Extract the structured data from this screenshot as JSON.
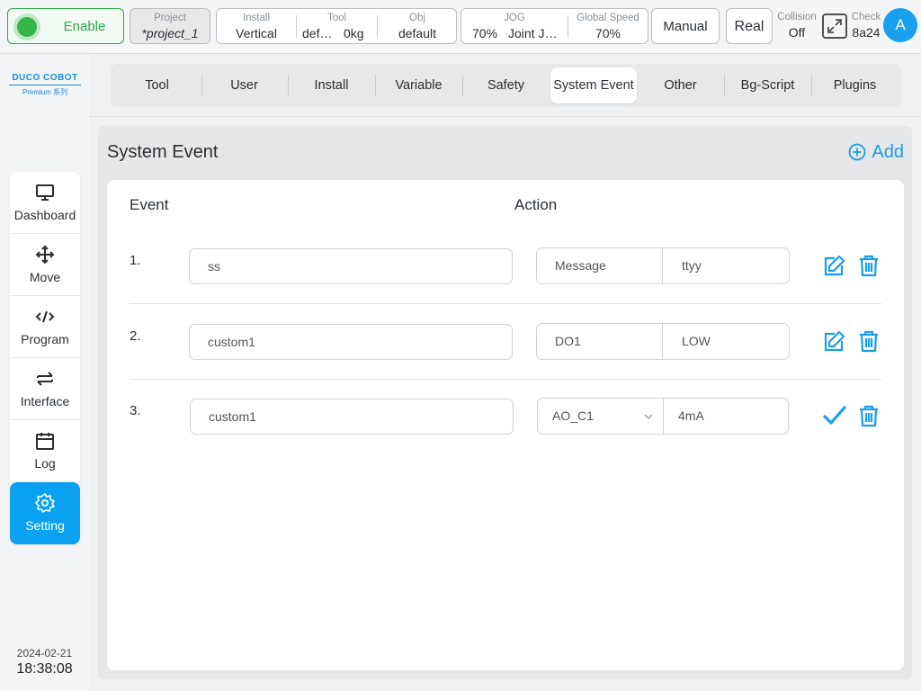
{
  "topbar": {
    "enable_label": "Enable",
    "project": {
      "caption": "Project",
      "value": "*project_1"
    },
    "install": {
      "caption": "Install",
      "value": "Vertical"
    },
    "tool": {
      "caption": "Tool",
      "name": "def…",
      "load": "0kg"
    },
    "obj": {
      "caption": "Obj",
      "value": "default"
    },
    "jog": {
      "caption": "JOG",
      "speed": "70%",
      "mode": "Joint J…"
    },
    "global_speed": {
      "caption": "Global Speed",
      "value": "70%"
    },
    "manual_label": "Manual",
    "real_label": "Real",
    "collision": {
      "caption": "Collision",
      "value": "Off"
    },
    "check": {
      "caption": "Check",
      "value": "8a24"
    },
    "avatar_letter": "A"
  },
  "sidebar": {
    "logo_main": "DUCO COBOT",
    "logo_sub": "Premium 系列",
    "items": [
      {
        "label": "Dashboard",
        "icon": "monitor-icon"
      },
      {
        "label": "Move",
        "icon": "move-arrows-icon"
      },
      {
        "label": "Program",
        "icon": "code-icon"
      },
      {
        "label": "Interface",
        "icon": "swap-arrows-icon"
      },
      {
        "label": "Log",
        "icon": "calendar-icon"
      },
      {
        "label": "Setting",
        "icon": "gear-icon",
        "active": true
      }
    ],
    "date": "2024-02-21",
    "time": "18:38:08"
  },
  "tabs": [
    "Tool",
    "User",
    "Install",
    "Variable",
    "Safety",
    "System Event",
    "Other",
    "Bg-Script",
    "Plugins"
  ],
  "active_tab": "System Event",
  "panel": {
    "title": "System Event",
    "add_label": "Add",
    "col_event": "Event",
    "col_action": "Action",
    "rows": [
      {
        "num": "1.",
        "event": "ss",
        "action_type": "Message",
        "action_value": "ttyy",
        "editing": false
      },
      {
        "num": "2.",
        "event": "custom1",
        "action_type": "DO1",
        "action_value": "LOW",
        "editing": false
      },
      {
        "num": "3.",
        "event": "custom1",
        "action_type": "AO_C1",
        "action_value": "4mA",
        "editing": true
      }
    ]
  },
  "colors": {
    "accent": "#1a9ee8",
    "enable_green": "#37b54a",
    "active_nav": "#0aa2f0"
  }
}
